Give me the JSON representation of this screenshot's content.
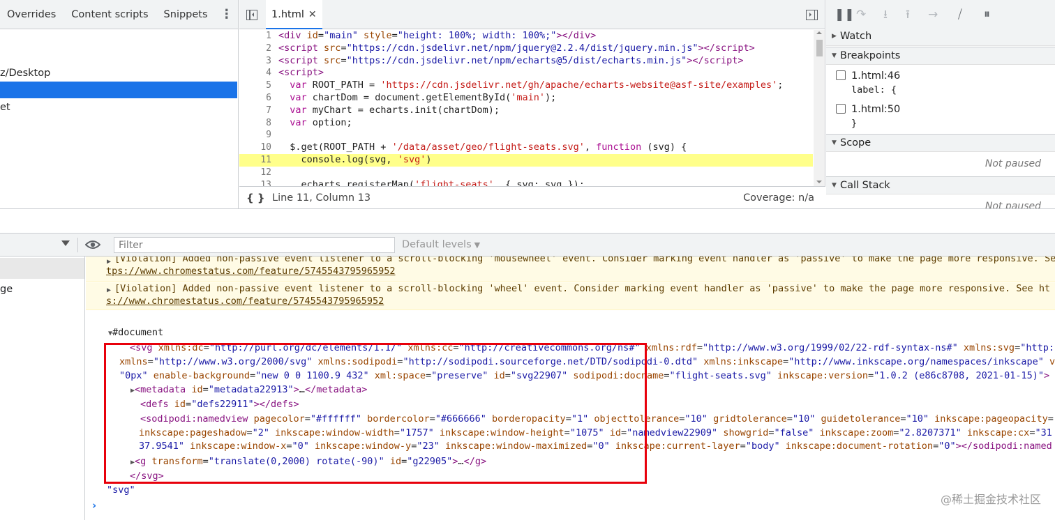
{
  "navigator": {
    "tabs": [
      "Overrides",
      "Content scripts",
      "Snippets"
    ],
    "tree": [
      "z/Desktop",
      "",
      "et"
    ]
  },
  "editor": {
    "file_tab": "1.html",
    "lines": [
      {
        "n": "1",
        "html": "<span class='tag'>&lt;div</span> <span class='attr'>id</span>=<span class='str'>\"main\"</span> <span class='attr'>style</span>=<span class='str'>\"height: 100%; width: 100%;\"</span><span class='tag'>&gt;&lt;/div&gt;</span>"
      },
      {
        "n": "2",
        "html": "<span class='tag'>&lt;script</span> <span class='attr'>src</span>=<span class='str'>\"https://cdn.jsdelivr.net/npm/jquery@2.2.4/dist/jquery.min.js\"</span><span class='tag'>&gt;&lt;/script&gt;</span>"
      },
      {
        "n": "3",
        "html": "<span class='tag'>&lt;script</span> <span class='attr'>src</span>=<span class='str'>\"https://cdn.jsdelivr.net/npm/echarts@5/dist/echarts.min.js\"</span><span class='tag'>&gt;&lt;/script&gt;</span>"
      },
      {
        "n": "4",
        "html": "<span class='tag'>&lt;script&gt;</span>"
      },
      {
        "n": "5",
        "html": "  <span class='kw'>var</span> ROOT_PATH = <span class='jsstr'>'https://cdn.jsdelivr.net/gh/apache/echarts-website@asf-site/examples'</span>;"
      },
      {
        "n": "6",
        "html": "  <span class='kw'>var</span> chartDom = document.getElementById(<span class='jsstr'>'main'</span>);"
      },
      {
        "n": "7",
        "html": "  <span class='kw'>var</span> myChart = echarts.init(chartDom);"
      },
      {
        "n": "8",
        "html": "  <span class='kw'>var</span> option;"
      },
      {
        "n": "9",
        "html": ""
      },
      {
        "n": "10",
        "html": "  $.get(ROOT_PATH + <span class='jsstr'>'/data/asset/geo/flight-seats.svg'</span>, <span class='kw'>function</span> (svg) {"
      },
      {
        "n": "11",
        "html": "    console.log(svg, <span class='jsstr'>'svg'</span>)",
        "hl": true
      },
      {
        "n": "12",
        "html": ""
      },
      {
        "n": "13",
        "html": "    echarts.registerMap(<span class='jsstr'>'flight-seats'</span>, { svg: svg });"
      }
    ],
    "pretty_print": "{ }",
    "cursor_position": "Line 11, Column 13",
    "coverage": "Coverage: n/a"
  },
  "debugger": {
    "watch": "Watch",
    "breakpoints": "Breakpoints",
    "bp1_label": "1.html:46",
    "bp1_code": "label: {",
    "bp2_label": "1.html:50",
    "bp2_code": "}",
    "scope": "Scope",
    "not_paused": "Not paused",
    "call_stack": "Call Stack",
    "not_paused2": "Not paused"
  },
  "console": {
    "filter_placeholder": "Filter",
    "levels": "Default levels",
    "side_row": "ge",
    "warn1_line1": "[Violation] Added non-passive event listener to a scroll-blocking 'mousewheel' event. Consider marking event handler as 'passive' to make the page more responsive. See",
    "warn1_link": "tps://www.chromestatus.com/feature/5745543795965952",
    "warn2_line1": "[Violation] Added non-passive event listener to a scroll-blocking 'wheel' event. Consider marking event handler as 'passive' to make the page more responsive. See ht",
    "warn2_link": "s://www.chromestatus.com/feature/5745543795965952",
    "document": "#document",
    "svg_line1": "<span class='x-tag'>&lt;svg</span> <span class='x-attr'>xmlns:dc</span>=<span class='x-val'>\"http://purl.org/dc/elements/1.1/\"</span> <span class='x-attr'>xmlns:cc</span>=<span class='x-val'>\"http://creativecommons.org/ns#\"</span> <span class='x-attr'>xmlns:rdf</span>=<span class='x-val'>\"http://www.w3.org/1999/02/22-rdf-syntax-ns#\"</span> <span class='x-attr'>xmlns:svg</span>=<span class='x-val'>\"http:</span>",
    "svg_line2": "<span class='x-attr'>xmlns</span>=<span class='x-val'>\"http://www.w3.org/2000/svg\"</span> <span class='x-attr'>xmlns:sodipodi</span>=<span class='x-val'>\"http://sodipodi.sourceforge.net/DTD/sodipodi-0.dtd\"</span> <span class='x-attr'>xmlns:inkscape</span>=<span class='x-val'>\"http://www.inkscape.org/namespaces/inkscape\"</span> <span class='x-attr'>v</span>",
    "svg_line3": "<span class='x-val'>\"0px\"</span> <span class='x-attr'>enable-background</span>=<span class='x-val'>\"new 0 0 1100.9 432\"</span> <span class='x-attr'>xml:space</span>=<span class='x-val'>\"preserve\"</span> <span class='x-attr'>id</span>=<span class='x-val'>\"svg22907\"</span> <span class='x-attr'>sodipodi:docname</span>=<span class='x-val'>\"flight-seats.svg\"</span> <span class='x-attr'>inkscape:version</span>=<span class='x-val'>\"1.0.2 (e86c8708, 2021-01-15)\"</span><span class='x-tag'>&gt;</span>",
    "metadata": "<span class='x-tag'>&lt;metadata</span> <span class='x-attr'>id</span>=<span class='x-val'>\"metadata22913\"</span><span class='x-tag'>&gt;</span>…<span class='x-tag'>&lt;/metadata&gt;</span>",
    "defs": "<span class='x-tag'>&lt;defs</span> <span class='x-attr'>id</span>=<span class='x-val'>\"defs22911\"</span><span class='x-tag'>&gt;&lt;/defs&gt;</span>",
    "namedview1": "<span class='x-tag'>&lt;sodipodi:namedview</span> <span class='x-attr'>pagecolor</span>=<span class='x-val'>\"#ffffff\"</span> <span class='x-attr'>bordercolor</span>=<span class='x-val'>\"#666666\"</span> <span class='x-attr'>borderopacity</span>=<span class='x-val'>\"1\"</span> <span class='x-attr'>objecttolerance</span>=<span class='x-val'>\"10\"</span> <span class='x-attr'>gridtolerance</span>=<span class='x-val'>\"10\"</span> <span class='x-attr'>guidetolerance</span>=<span class='x-val'>\"10\"</span> <span class='x-attr'>inkscape:pageopacity</span>=",
    "namedview2": "<span class='x-attr'>inkscape:pageshadow</span>=<span class='x-val'>\"2\"</span> <span class='x-attr'>inkscape:window-width</span>=<span class='x-val'>\"1757\"</span> <span class='x-attr'>inkscape:window-height</span>=<span class='x-val'>\"1075\"</span> <span class='x-attr'>id</span>=<span class='x-val'>\"namedview22909\"</span> <span class='x-attr'>showgrid</span>=<span class='x-val'>\"false\"</span> <span class='x-attr'>inkscape:zoom</span>=<span class='x-val'>\"2.8207371\"</span> <span class='x-attr'>inkscape:cx</span>=<span class='x-val'>\"31</span>",
    "namedview3": "<span class='x-val'>37.9541\"</span> <span class='x-attr'>inkscape:window-x</span>=<span class='x-val'>\"0\"</span> <span class='x-attr'>inkscape:window-y</span>=<span class='x-val'>\"23\"</span> <span class='x-attr'>inkscape:window-maximized</span>=<span class='x-val'>\"0\"</span> <span class='x-attr'>inkscape:current-layer</span>=<span class='x-val'>\"body\"</span> <span class='x-attr'>inkscape:document-rotation</span>=<span class='x-val'>\"0\"</span><span class='x-tag'>&gt;&lt;/sodipodi:named</span>",
    "g_line": "<span class='x-tag'>&lt;g</span> <span class='x-attr'>transform</span>=<span class='x-val'>\"translate(0,2000) rotate(-90)\"</span> <span class='x-attr'>id</span>=<span class='x-val'>\"g22905\"</span><span class='x-tag'>&gt;</span>…<span class='x-tag'>&lt;/g&gt;</span>",
    "svg_close": "&lt;/svg&gt;",
    "svg_string": "\"svg\"",
    "prompt": "›"
  },
  "watermark": "@稀土掘金技术社区",
  "colors": {
    "accent": "#1a73e8",
    "highlight": "#ffff8a",
    "warning_bg": "#fffbe5",
    "red_box": "#e8000b"
  },
  "icons": [
    "more-vert-icon",
    "toggle-navigator-icon",
    "close-icon",
    "toggle-debugger-icon",
    "pause-icon",
    "step-over-icon",
    "step-into-icon",
    "step-out-icon",
    "step-icon",
    "deactivate-breakpoints-icon",
    "pause-on-exceptions-icon",
    "eye-icon",
    "expand-triangle-icon",
    "chevron-right-icon"
  ]
}
